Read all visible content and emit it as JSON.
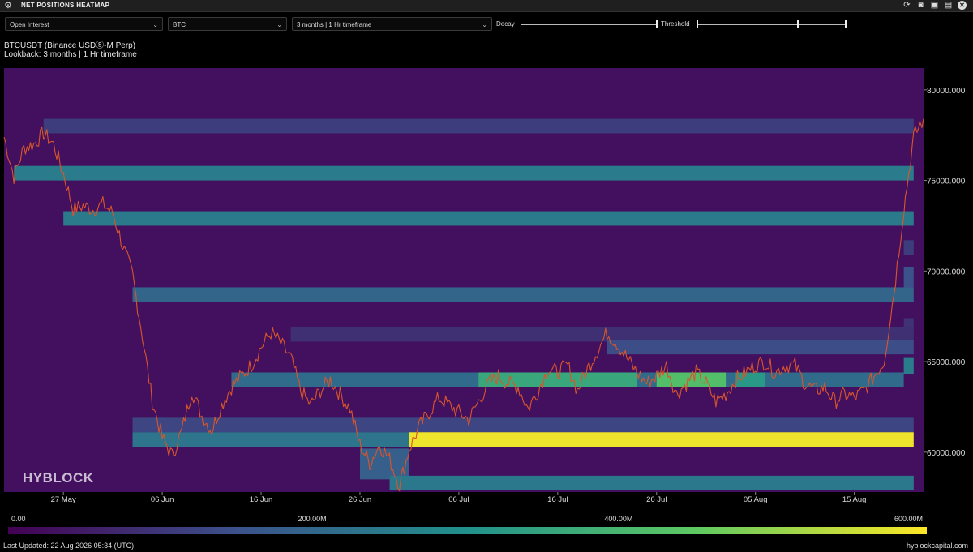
{
  "window": {
    "title": "NET POSITIONS HEATMAP",
    "icons": [
      "refresh-icon",
      "camera-icon",
      "floppy-disk-icon",
      "document-icon",
      "close-icon"
    ]
  },
  "controls": {
    "metric": "Open Interest",
    "coin": "BTC",
    "lookback": "3 months | 1 Hr timeframe",
    "decay_label": "Decay",
    "decay_value": 1.0,
    "threshold_label": "Threshold",
    "threshold_value": 0.68
  },
  "subtitle": {
    "symbol": "BTCUSDT (Binance USDⓈ-M Perp)",
    "lookback": "Lookback: 3 months | 1 Hr timeframe"
  },
  "watermark": "HYBLOCK",
  "legend": {
    "labels": [
      "0.00",
      "200.00M",
      "400.00M",
      "600.00M"
    ],
    "min": 0,
    "max": 600
  },
  "footer": {
    "last_updated": "Last Updated: 22 Aug 2026 05:34 (UTC)",
    "site": "hyblockcapital.com"
  },
  "colors": {
    "background": "#000000",
    "heat_low": "#440154",
    "heat_mid": "#21918c",
    "heat_high": "#fde725",
    "price_line": "#d9552b"
  },
  "chart_data": {
    "type": "heatmap",
    "title": "",
    "xlabel": "",
    "ylabel": "",
    "x_range": [
      "2026-05-21",
      "2026-08-22"
    ],
    "ylim": [
      57800,
      81200
    ],
    "x_ticks": [
      {
        "date": "2026-05-27",
        "label": "27 May"
      },
      {
        "date": "2026-06-06",
        "label": "06 Jun"
      },
      {
        "date": "2026-06-16",
        "label": "16 Jun"
      },
      {
        "date": "2026-06-26",
        "label": "26 Jun"
      },
      {
        "date": "2026-07-06",
        "label": "06 Jul"
      },
      {
        "date": "2026-07-16",
        "label": "16 Jul"
      },
      {
        "date": "2026-07-26",
        "label": "26 Jul"
      },
      {
        "date": "2026-08-05",
        "label": "05 Aug"
      },
      {
        "date": "2026-08-15",
        "label": "15 Aug"
      }
    ],
    "y_ticks": [
      {
        "value": 60000,
        "label": "60000.000"
      },
      {
        "value": 65000,
        "label": "65000.000"
      },
      {
        "value": 70000,
        "label": "70000.000"
      },
      {
        "value": 75000,
        "label": "75000.000"
      },
      {
        "value": 80000,
        "label": "80000.000"
      }
    ],
    "bands": [
      {
        "start": "2026-05-25",
        "end": "2026-08-21",
        "y_low": 77600,
        "y_high": 78400,
        "value": 110
      },
      {
        "start": "2026-05-22",
        "end": "2026-08-21",
        "y_low": 75000,
        "y_high": 75800,
        "value": 250
      },
      {
        "start": "2026-05-27",
        "end": "2026-08-21",
        "y_low": 72500,
        "y_high": 73300,
        "value": 245
      },
      {
        "start": "2026-08-20",
        "end": "2026-08-21",
        "y_low": 70900,
        "y_high": 71700,
        "value": 110
      },
      {
        "start": "2026-06-03",
        "end": "2026-08-21",
        "y_low": 68300,
        "y_high": 69100,
        "value": 195
      },
      {
        "start": "2026-08-20",
        "end": "2026-08-21",
        "y_low": 69100,
        "y_high": 70200,
        "value": 150
      },
      {
        "start": "2026-08-20",
        "end": "2026-08-21",
        "y_low": 66600,
        "y_high": 67400,
        "value": 90
      },
      {
        "start": "2026-06-19",
        "end": "2026-08-21",
        "y_low": 66100,
        "y_high": 66900,
        "value": 85
      },
      {
        "start": "2026-07-21",
        "end": "2026-08-21",
        "y_low": 65400,
        "y_high": 66200,
        "value": 140
      },
      {
        "start": "2026-08-20",
        "end": "2026-08-21",
        "y_low": 64300,
        "y_high": 65200,
        "value": 250
      },
      {
        "start": "2026-06-13",
        "end": "2026-08-20",
        "y_low": 63600,
        "y_high": 64400,
        "value": 210
      },
      {
        "start": "2026-07-08",
        "end": "2026-07-24",
        "y_low": 63600,
        "y_high": 64400,
        "value": 360
      },
      {
        "start": "2026-07-26",
        "end": "2026-08-02",
        "y_low": 63600,
        "y_high": 64400,
        "value": 420
      },
      {
        "start": "2026-08-03",
        "end": "2026-08-06",
        "y_low": 63600,
        "y_high": 64400,
        "value": 320
      },
      {
        "start": "2026-06-03",
        "end": "2026-08-21",
        "y_low": 61100,
        "y_high": 61900,
        "value": 125
      },
      {
        "start": "2026-06-03",
        "end": "2026-07-01",
        "y_low": 60300,
        "y_high": 61100,
        "value": 230
      },
      {
        "start": "2026-07-01",
        "end": "2026-08-21",
        "y_low": 60300,
        "y_high": 61100,
        "value": 585
      },
      {
        "start": "2026-06-26",
        "end": "2026-07-01",
        "y_low": 58500,
        "y_high": 60200,
        "value": 180
      },
      {
        "start": "2026-06-29",
        "end": "2026-08-21",
        "y_low": 57900,
        "y_high": 58700,
        "value": 240
      }
    ],
    "price_series": [
      {
        "date": "2026-05-21",
        "value": 77400
      },
      {
        "date": "2026-05-22",
        "value": 75200
      },
      {
        "date": "2026-05-23",
        "value": 76800
      },
      {
        "date": "2026-05-24",
        "value": 77000
      },
      {
        "date": "2026-05-25",
        "value": 77600
      },
      {
        "date": "2026-05-26",
        "value": 77000
      },
      {
        "date": "2026-05-27",
        "value": 75400
      },
      {
        "date": "2026-05-28",
        "value": 73400
      },
      {
        "date": "2026-05-29",
        "value": 73600
      },
      {
        "date": "2026-05-30",
        "value": 73400
      },
      {
        "date": "2026-05-31",
        "value": 73700
      },
      {
        "date": "2026-06-01",
        "value": 73200
      },
      {
        "date": "2026-06-02",
        "value": 71400
      },
      {
        "date": "2026-06-03",
        "value": 69800
      },
      {
        "date": "2026-06-04",
        "value": 66400
      },
      {
        "date": "2026-06-05",
        "value": 62800
      },
      {
        "date": "2026-06-06",
        "value": 60800
      },
      {
        "date": "2026-06-07",
        "value": 59800
      },
      {
        "date": "2026-06-08",
        "value": 61200
      },
      {
        "date": "2026-06-09",
        "value": 63400
      },
      {
        "date": "2026-06-10",
        "value": 62000
      },
      {
        "date": "2026-06-11",
        "value": 61200
      },
      {
        "date": "2026-06-12",
        "value": 62600
      },
      {
        "date": "2026-06-13",
        "value": 63600
      },
      {
        "date": "2026-06-14",
        "value": 64200
      },
      {
        "date": "2026-06-15",
        "value": 64800
      },
      {
        "date": "2026-06-16",
        "value": 65800
      },
      {
        "date": "2026-06-17",
        "value": 66600
      },
      {
        "date": "2026-06-18",
        "value": 66000
      },
      {
        "date": "2026-06-19",
        "value": 65200
      },
      {
        "date": "2026-06-20",
        "value": 63400
      },
      {
        "date": "2026-06-21",
        "value": 62600
      },
      {
        "date": "2026-06-22",
        "value": 63400
      },
      {
        "date": "2026-06-23",
        "value": 64000
      },
      {
        "date": "2026-06-24",
        "value": 63200
      },
      {
        "date": "2026-06-25",
        "value": 62400
      },
      {
        "date": "2026-06-26",
        "value": 60400
      },
      {
        "date": "2026-06-27",
        "value": 59400
      },
      {
        "date": "2026-06-28",
        "value": 60400
      },
      {
        "date": "2026-06-29",
        "value": 59600
      },
      {
        "date": "2026-06-30",
        "value": 58200
      },
      {
        "date": "2026-07-01",
        "value": 60200
      },
      {
        "date": "2026-07-02",
        "value": 61400
      },
      {
        "date": "2026-07-03",
        "value": 62200
      },
      {
        "date": "2026-07-04",
        "value": 63000
      },
      {
        "date": "2026-07-05",
        "value": 62600
      },
      {
        "date": "2026-07-06",
        "value": 62200
      },
      {
        "date": "2026-07-07",
        "value": 61800
      },
      {
        "date": "2026-07-08",
        "value": 62800
      },
      {
        "date": "2026-07-09",
        "value": 63800
      },
      {
        "date": "2026-07-10",
        "value": 64200
      },
      {
        "date": "2026-07-11",
        "value": 63800
      },
      {
        "date": "2026-07-12",
        "value": 63600
      },
      {
        "date": "2026-07-13",
        "value": 62400
      },
      {
        "date": "2026-07-14",
        "value": 63400
      },
      {
        "date": "2026-07-15",
        "value": 64600
      },
      {
        "date": "2026-07-16",
        "value": 64400
      },
      {
        "date": "2026-07-17",
        "value": 64800
      },
      {
        "date": "2026-07-18",
        "value": 63400
      },
      {
        "date": "2026-07-19",
        "value": 64600
      },
      {
        "date": "2026-07-20",
        "value": 65600
      },
      {
        "date": "2026-07-21",
        "value": 66600
      },
      {
        "date": "2026-07-22",
        "value": 66000
      },
      {
        "date": "2026-07-23",
        "value": 65200
      },
      {
        "date": "2026-07-24",
        "value": 64400
      },
      {
        "date": "2026-07-25",
        "value": 63800
      },
      {
        "date": "2026-07-26",
        "value": 64200
      },
      {
        "date": "2026-07-27",
        "value": 64800
      },
      {
        "date": "2026-07-28",
        "value": 63200
      },
      {
        "date": "2026-07-29",
        "value": 63800
      },
      {
        "date": "2026-07-30",
        "value": 64400
      },
      {
        "date": "2026-07-31",
        "value": 63800
      },
      {
        "date": "2026-08-01",
        "value": 62800
      },
      {
        "date": "2026-08-02",
        "value": 63200
      },
      {
        "date": "2026-08-03",
        "value": 64000
      },
      {
        "date": "2026-08-04",
        "value": 64400
      },
      {
        "date": "2026-08-05",
        "value": 64800
      },
      {
        "date": "2026-08-06",
        "value": 65000
      },
      {
        "date": "2026-08-07",
        "value": 64400
      },
      {
        "date": "2026-08-08",
        "value": 64800
      },
      {
        "date": "2026-08-09",
        "value": 64800
      },
      {
        "date": "2026-08-10",
        "value": 63800
      },
      {
        "date": "2026-08-11",
        "value": 63400
      },
      {
        "date": "2026-08-12",
        "value": 63600
      },
      {
        "date": "2026-08-13",
        "value": 62800
      },
      {
        "date": "2026-08-14",
        "value": 63200
      },
      {
        "date": "2026-08-15",
        "value": 63000
      },
      {
        "date": "2026-08-16",
        "value": 63400
      },
      {
        "date": "2026-08-17",
        "value": 64200
      },
      {
        "date": "2026-08-18",
        "value": 65000
      },
      {
        "date": "2026-08-19",
        "value": 68800
      },
      {
        "date": "2026-08-20",
        "value": 73400
      },
      {
        "date": "2026-08-21",
        "value": 77400
      },
      {
        "date": "2026-08-22",
        "value": 78400
      }
    ]
  }
}
